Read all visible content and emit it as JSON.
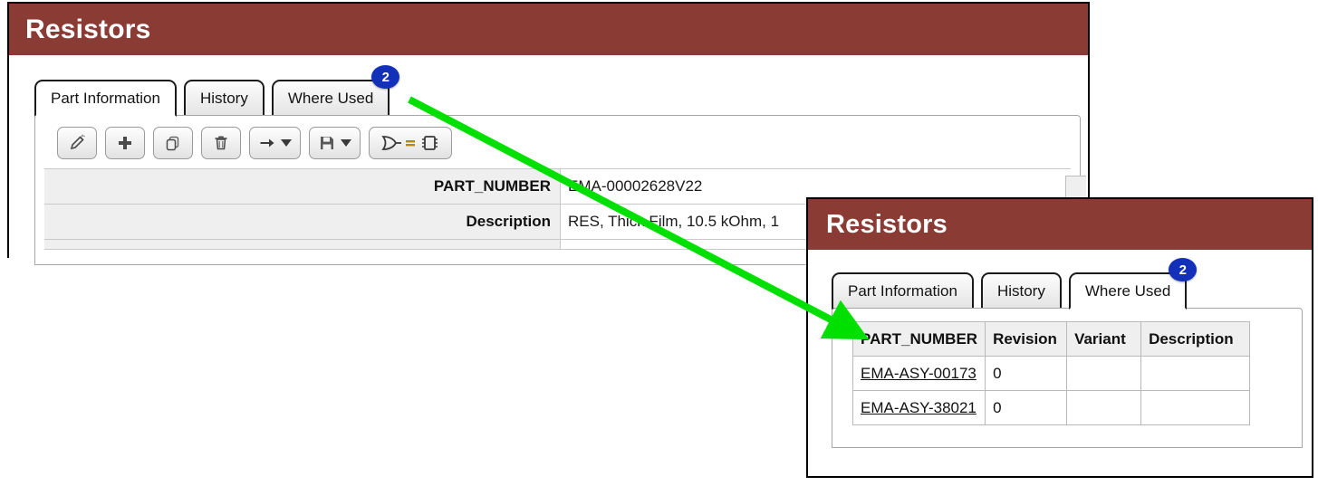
{
  "main_window": {
    "title": "Resistors",
    "tabs": [
      {
        "label": "Part Information",
        "active": true,
        "badge": null
      },
      {
        "label": "History",
        "active": false,
        "badge": null
      },
      {
        "label": "Where Used",
        "active": false,
        "badge": "2"
      }
    ],
    "toolbar": [
      {
        "name": "edit-button",
        "icon": "pencil-icon",
        "caret": false
      },
      {
        "name": "add-button",
        "icon": "plus-icon",
        "caret": false
      },
      {
        "name": "copy-button",
        "icon": "copy-icon",
        "caret": false
      },
      {
        "name": "delete-button",
        "icon": "trash-icon",
        "caret": false
      },
      {
        "name": "move-button",
        "icon": "arrow-right-icon",
        "caret": true
      },
      {
        "name": "save-button",
        "icon": "floppy-disk-icon",
        "caret": true
      },
      {
        "name": "symbol-equals-part-button",
        "icon": "logic-gate-equals-chip-icon",
        "caret": false
      }
    ],
    "fields": [
      {
        "label": "PART_NUMBER",
        "value": "EMA-00002628V22"
      },
      {
        "label": "Description",
        "value": "RES, Thick Film, 10.5 kOhm, 1"
      }
    ]
  },
  "inset_window": {
    "title": "Resistors",
    "tabs": [
      {
        "label": "Part Information",
        "active": false,
        "badge": null
      },
      {
        "label": "History",
        "active": false,
        "badge": null
      },
      {
        "label": "Where Used",
        "active": true,
        "badge": "2"
      }
    ],
    "table": {
      "columns": [
        "PART_NUMBER",
        "Revision",
        "Variant",
        "Description"
      ],
      "rows": [
        {
          "part_number": "EMA-ASY-00173",
          "revision": "0",
          "variant": "",
          "description": ""
        },
        {
          "part_number": "EMA-ASY-38021",
          "revision": "0",
          "variant": "",
          "description": ""
        }
      ]
    }
  },
  "annotation": {
    "arrow_color": "#00e000",
    "from_label": "Where Used",
    "to_label": "PART_NUMBER"
  },
  "colors": {
    "title_bar": "#8a3b34",
    "badge": "#1330b8",
    "arrow": "#00e000",
    "panel_header_fill": "#efefef"
  }
}
